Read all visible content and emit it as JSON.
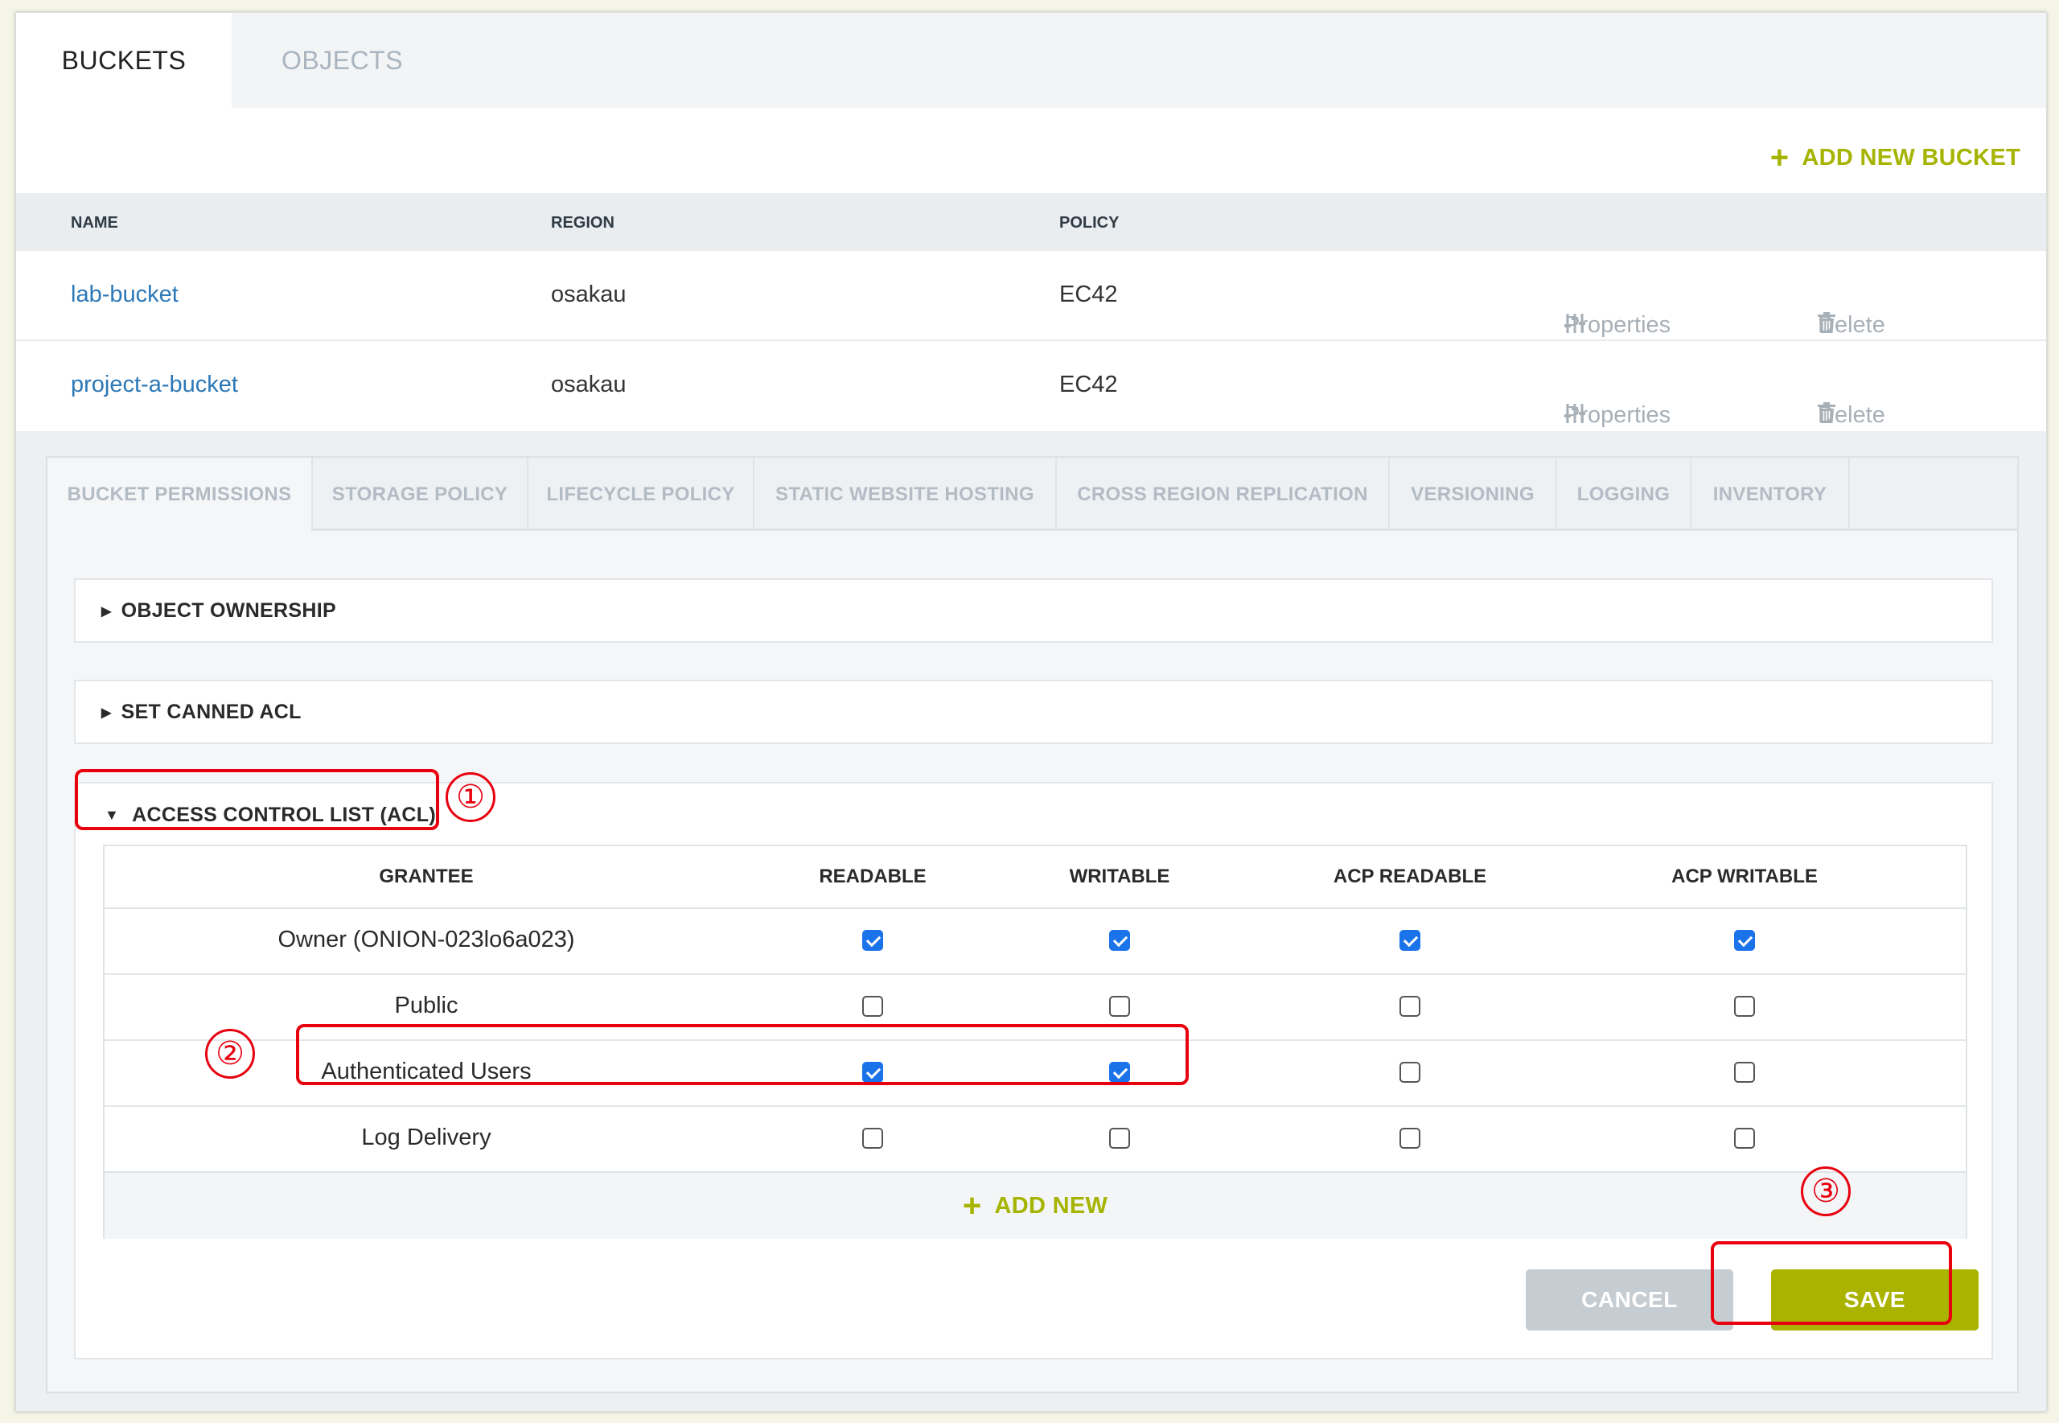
{
  "top_tabs": {
    "buckets": "BUCKETS",
    "objects": "OBJECTS"
  },
  "add_bucket_label": "ADD NEW BUCKET",
  "bucket_table": {
    "headers": {
      "name": "NAME",
      "region": "REGION",
      "policy": "POLICY"
    },
    "rows": [
      {
        "name": "lab-bucket",
        "region": "osakau",
        "policy": "EC42",
        "properties": "Properties",
        "delete": "Delete"
      },
      {
        "name": "project-a-bucket",
        "region": "osakau",
        "policy": "EC42",
        "properties": "Properties",
        "delete": "Delete"
      }
    ]
  },
  "property_tabs": [
    "BUCKET PERMISSIONS",
    "STORAGE POLICY",
    "LIFECYCLE POLICY",
    "STATIC WEBSITE HOSTING",
    "CROSS REGION REPLICATION",
    "VERSIONING",
    "LOGGING",
    "INVENTORY"
  ],
  "sections": {
    "object_ownership": "OBJECT OWNERSHIP",
    "canned_acl": "SET CANNED ACL",
    "acl": "ACCESS CONTROL LIST (ACL)"
  },
  "acl_table": {
    "headers": {
      "grantee": "GRANTEE",
      "readable": "READABLE",
      "writable": "WRITABLE",
      "acp_readable": "ACP READABLE",
      "acp_writable": "ACP WRITABLE"
    },
    "rows": [
      {
        "grantee": "Owner (ONION-023lo6a023)",
        "readable": true,
        "writable": true,
        "acp_readable": true,
        "acp_writable": true
      },
      {
        "grantee": "Public",
        "readable": false,
        "writable": false,
        "acp_readable": false,
        "acp_writable": false
      },
      {
        "grantee": "Authenticated Users",
        "readable": true,
        "writable": true,
        "acp_readable": false,
        "acp_writable": false
      },
      {
        "grantee": "Log Delivery",
        "readable": false,
        "writable": false,
        "acp_readable": false,
        "acp_writable": false
      }
    ],
    "add_new": "ADD NEW"
  },
  "buttons": {
    "cancel": "CANCEL",
    "save": "SAVE"
  },
  "annotations": {
    "step1": "①",
    "step2": "②",
    "step3": "③"
  },
  "colors": {
    "accent": "#aab300",
    "link": "#2b78b7",
    "annotation": "#e8000f",
    "checkbox": "#1a73e8"
  },
  "icons": {
    "properties": "sliders-icon",
    "delete": "trash-icon",
    "add": "plus-icon"
  }
}
